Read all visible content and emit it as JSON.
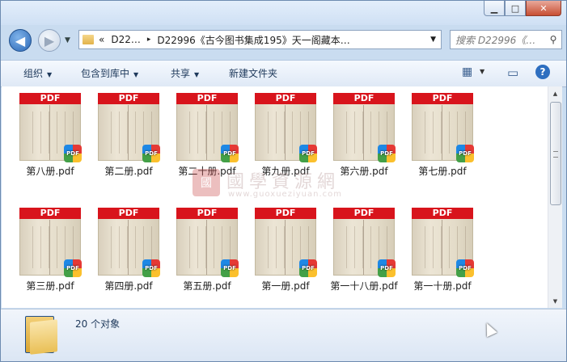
{
  "window": {
    "controls": {
      "minimize": "▁",
      "maximize": "□",
      "close": "✕"
    }
  },
  "nav": {
    "back_icon": "◀",
    "forward_icon": "▶",
    "history_dropdown": "▼"
  },
  "address": {
    "prefix": "«",
    "crumbs": [
      "D22…",
      "D22996《古今图书集成195》天一阁藏本…"
    ],
    "separator": "▸",
    "dropdown": "▼"
  },
  "refresh_icon": "⟳",
  "search": {
    "placeholder": "搜索 D22996《…",
    "icon": "⚲"
  },
  "toolbar": {
    "organize": "组织",
    "include_library": "包含到库中",
    "share": "共享",
    "new_folder": "新建文件夹",
    "caret": "▼",
    "view_icon": "▦",
    "preview_icon": "▭",
    "help_icon": "?"
  },
  "files": {
    "pdf_tag": "PDF",
    "badge_text": "PDF",
    "items": [
      {
        "name": "第八册.pdf"
      },
      {
        "name": "第二册.pdf"
      },
      {
        "name": "第二十册.pdf"
      },
      {
        "name": "第九册.pdf"
      },
      {
        "name": "第六册.pdf"
      },
      {
        "name": "第七册.pdf"
      },
      {
        "name": "第三册.pdf"
      },
      {
        "name": "第四册.pdf"
      },
      {
        "name": "第五册.pdf"
      },
      {
        "name": "第一册.pdf"
      },
      {
        "name": "第一十八册.pdf"
      },
      {
        "name": "第一十册.pdf"
      }
    ]
  },
  "watermark": {
    "seal": "國",
    "title": "國學資源網",
    "url": "www.guoxueziyuan.com"
  },
  "status": {
    "count": "20 个对象"
  },
  "colors": {
    "pdf_red": "#d8141c",
    "toolbar_text": "#1e395b",
    "frame": "#c9dcf0"
  }
}
